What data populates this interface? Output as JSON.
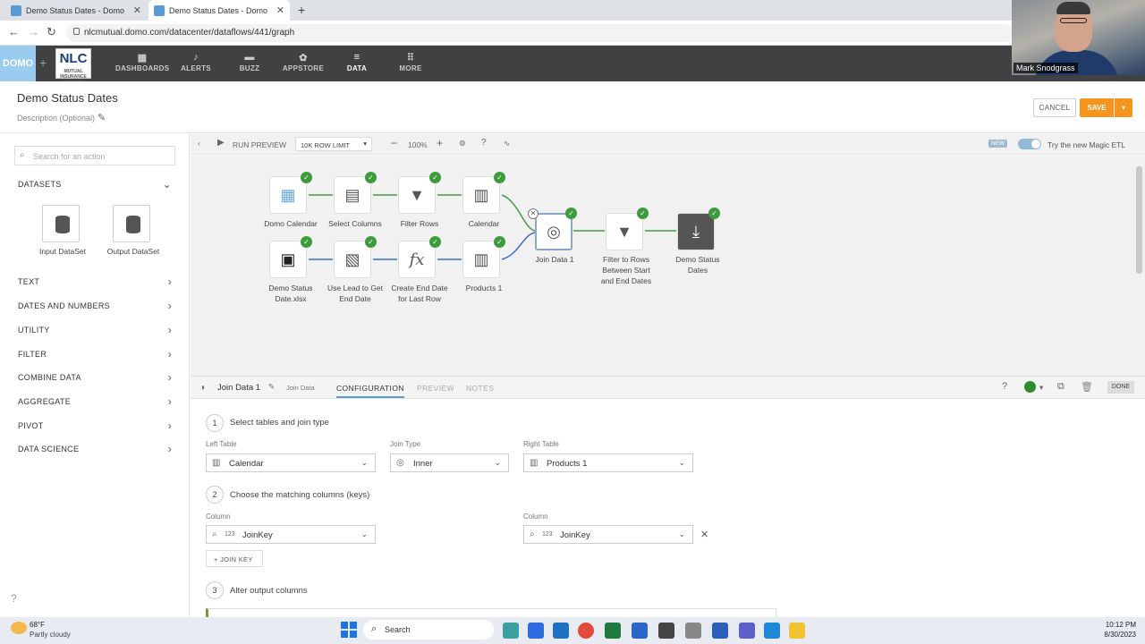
{
  "browser": {
    "tabs": [
      {
        "title": "Demo Status Dates - Domo"
      },
      {
        "title": "Demo Status Dates - Domo"
      }
    ],
    "url": "nlcmutual.domo.com/datacenter/dataflows/441/graph"
  },
  "topnav": {
    "logo": "DOMO",
    "partner_logo": "NLC",
    "partner_sub": "MUTUAL INSURANCE COMPANY",
    "items": [
      {
        "label": "DASHBOARDS",
        "icon": "dashboard-icon"
      },
      {
        "label": "ALERTS",
        "icon": "bell-icon"
      },
      {
        "label": "BUZZ",
        "icon": "chat-icon"
      },
      {
        "label": "APPSTORE",
        "icon": "appstore-icon"
      },
      {
        "label": "DATA",
        "icon": "database-icon"
      },
      {
        "label": "MORE",
        "icon": "grid-icon"
      }
    ]
  },
  "video": {
    "name": "Mark Snodgrass"
  },
  "header": {
    "title": "Demo Status Dates",
    "description_placeholder": "Description (Optional)",
    "cancel_label": "CANCEL",
    "save_label": "SAVE"
  },
  "sidebar": {
    "search_placeholder": "Search for an action",
    "datasets_label": "DATASETS",
    "dataset_tiles": [
      {
        "label": "Input DataSet"
      },
      {
        "label": "Output DataSet"
      }
    ],
    "sections": [
      "TEXT",
      "DATES AND NUMBERS",
      "UTILITY",
      "FILTER",
      "COMBINE DATA",
      "AGGREGATE",
      "PIVOT",
      "DATA SCIENCE"
    ]
  },
  "toolbar": {
    "run_preview": "RUN PREVIEW",
    "row_limit": "10K ROW LIMIT",
    "zoom": "100%",
    "new_badge": "NEW",
    "magic_etl": "Try the new Magic ETL"
  },
  "nodes": {
    "domo_calendar": "Domo Calendar",
    "select_columns": "Select Columns",
    "filter_rows": "Filter Rows",
    "calendar": "Calendar",
    "demo_status_date_xlsx_1": "Demo Status",
    "demo_status_date_xlsx_2": "Date.xlsx",
    "use_lead_1": "Use Lead to Get",
    "use_lead_2": "End Date",
    "create_end_1": "Create End Date",
    "create_end_2": "for Last Row",
    "products": "Products 1",
    "join": "Join Data 1",
    "filter_between_1": "Filter to Rows",
    "filter_between_2": "Between Start",
    "filter_between_3": "and End Dates",
    "output_1": "Demo Status",
    "output_2": "Dates"
  },
  "panel": {
    "name": "Join Data 1",
    "type": "Join Data",
    "tabs": [
      "CONFIGURATION",
      "PREVIEW",
      "NOTES"
    ],
    "done": "DONE",
    "step1": "Select tables and join type",
    "step2": "Choose the matching columns (keys)",
    "step3": "Alter output columns",
    "left_table_label": "Left Table",
    "left_table": "Calendar",
    "join_type_label": "Join Type",
    "join_type": "Inner",
    "right_table_label": "Right Table",
    "right_table": "Products 1",
    "column_label": "Column",
    "left_column": "JoinKey",
    "right_column": "JoinKey",
    "column_type": "123",
    "join_key_button": "JOIN KEY"
  },
  "taskbar": {
    "temp": "68°F",
    "weather": "Partly cloudy",
    "search": "Search",
    "time": "10:12 PM",
    "date": "8/30/2023"
  }
}
